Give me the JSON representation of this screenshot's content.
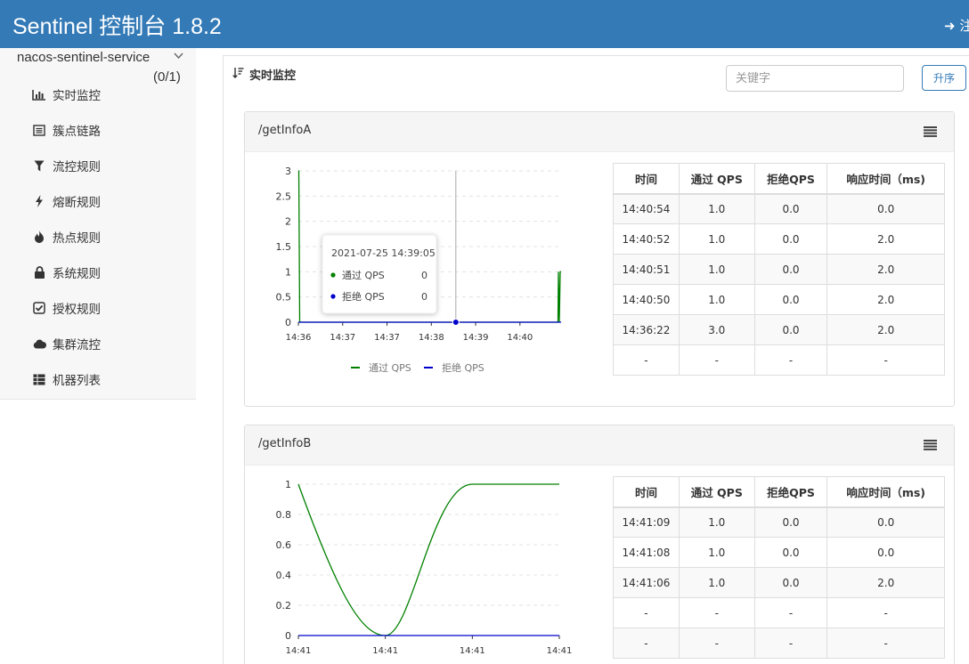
{
  "header": {
    "title": "Sentinel 控制台 1.8.2",
    "logout_label": "注销"
  },
  "sidebar": {
    "service_name": "nacos-sentinel-service",
    "service_count": "(0/1)",
    "items": [
      {
        "label": "实时监控",
        "icon": "bar-chart-icon"
      },
      {
        "label": "簇点链路",
        "icon": "list-icon"
      },
      {
        "label": "流控规则",
        "icon": "filter-icon"
      },
      {
        "label": "熔断规则",
        "icon": "bolt-icon"
      },
      {
        "label": "热点规则",
        "icon": "fire-icon"
      },
      {
        "label": "系统规则",
        "icon": "lock-icon"
      },
      {
        "label": "授权规则",
        "icon": "check-square-icon"
      },
      {
        "label": "集群流控",
        "icon": "cloud-icon"
      },
      {
        "label": "机器列表",
        "icon": "th-list-icon"
      }
    ]
  },
  "main": {
    "title": "实时监控",
    "search": {
      "placeholder": "关键字",
      "value": ""
    },
    "sort_button": "升序"
  },
  "table_headers": [
    "时间",
    "通过 QPS",
    "拒绝QPS",
    "响应时间（ms)"
  ],
  "resources": [
    {
      "name": "/getInfoA",
      "rows": [
        [
          "14:40:54",
          "1.0",
          "0.0",
          "0.0"
        ],
        [
          "14:40:52",
          "1.0",
          "0.0",
          "2.0"
        ],
        [
          "14:40:51",
          "1.0",
          "0.0",
          "2.0"
        ],
        [
          "14:40:50",
          "1.0",
          "0.0",
          "2.0"
        ],
        [
          "14:36:22",
          "3.0",
          "0.0",
          "2.0"
        ],
        [
          "-",
          "-",
          "-",
          "-"
        ]
      ],
      "tooltip": {
        "time": "2021-07-25 14:39:05",
        "items": [
          {
            "label": "通过 QPS",
            "value": "0",
            "color": "#008000"
          },
          {
            "label": "拒绝 QPS",
            "value": "0",
            "color": "#0000cc"
          }
        ]
      }
    },
    {
      "name": "/getInfoB",
      "rows": [
        [
          "14:41:09",
          "1.0",
          "0.0",
          "0.0"
        ],
        [
          "14:41:08",
          "1.0",
          "0.0",
          "0.0"
        ],
        [
          "14:41:06",
          "1.0",
          "0.0",
          "2.0"
        ],
        [
          "-",
          "-",
          "-",
          "-"
        ],
        [
          "-",
          "-",
          "-",
          "-"
        ]
      ]
    }
  ],
  "chart_data": [
    {
      "type": "line",
      "x_tick_labels": [
        "14:36",
        "14:37",
        "14:37",
        "14:38",
        "14:39",
        "14:40"
      ],
      "y_tick_labels": [
        "0",
        "0.5",
        "1",
        "1.5",
        "2",
        "2.5",
        "3"
      ],
      "ylim": [
        0,
        3
      ],
      "xlim_minutes": [
        0,
        5.8
      ],
      "legend_position": "bottom-center",
      "series": [
        {
          "name": "通过 QPS",
          "color": "#008000",
          "x_minutes": [
            0,
            0.01,
            0.03,
            5.77,
            5.78,
            5.8,
            5.82,
            5.84
          ],
          "values": [
            3,
            3,
            0,
            0,
            1,
            0,
            1,
            1
          ]
        },
        {
          "name": "拒绝 QPS",
          "color": "#0000cc",
          "x_minutes": [
            0,
            5.84
          ],
          "values": [
            0,
            0
          ]
        }
      ],
      "crosshair_x_minutes": 3.5
    },
    {
      "type": "line",
      "x_tick_labels": [
        "14:41",
        "14:41",
        "14:41",
        "14:41"
      ],
      "y_tick_labels": [
        "0",
        "0.2",
        "0.4",
        "0.6",
        "0.8",
        "1"
      ],
      "ylim": [
        0,
        1
      ],
      "xlim": [
        0,
        3
      ],
      "series": [
        {
          "name": "通过 QPS",
          "color": "#008000",
          "shape": "smooth-dip",
          "x": [
            0,
            1,
            2,
            3
          ],
          "values": [
            1,
            0,
            1,
            1
          ]
        },
        {
          "name": "拒绝 QPS",
          "color": "#0000cc",
          "x": [
            0,
            3
          ],
          "values": [
            0,
            0
          ]
        }
      ]
    }
  ]
}
